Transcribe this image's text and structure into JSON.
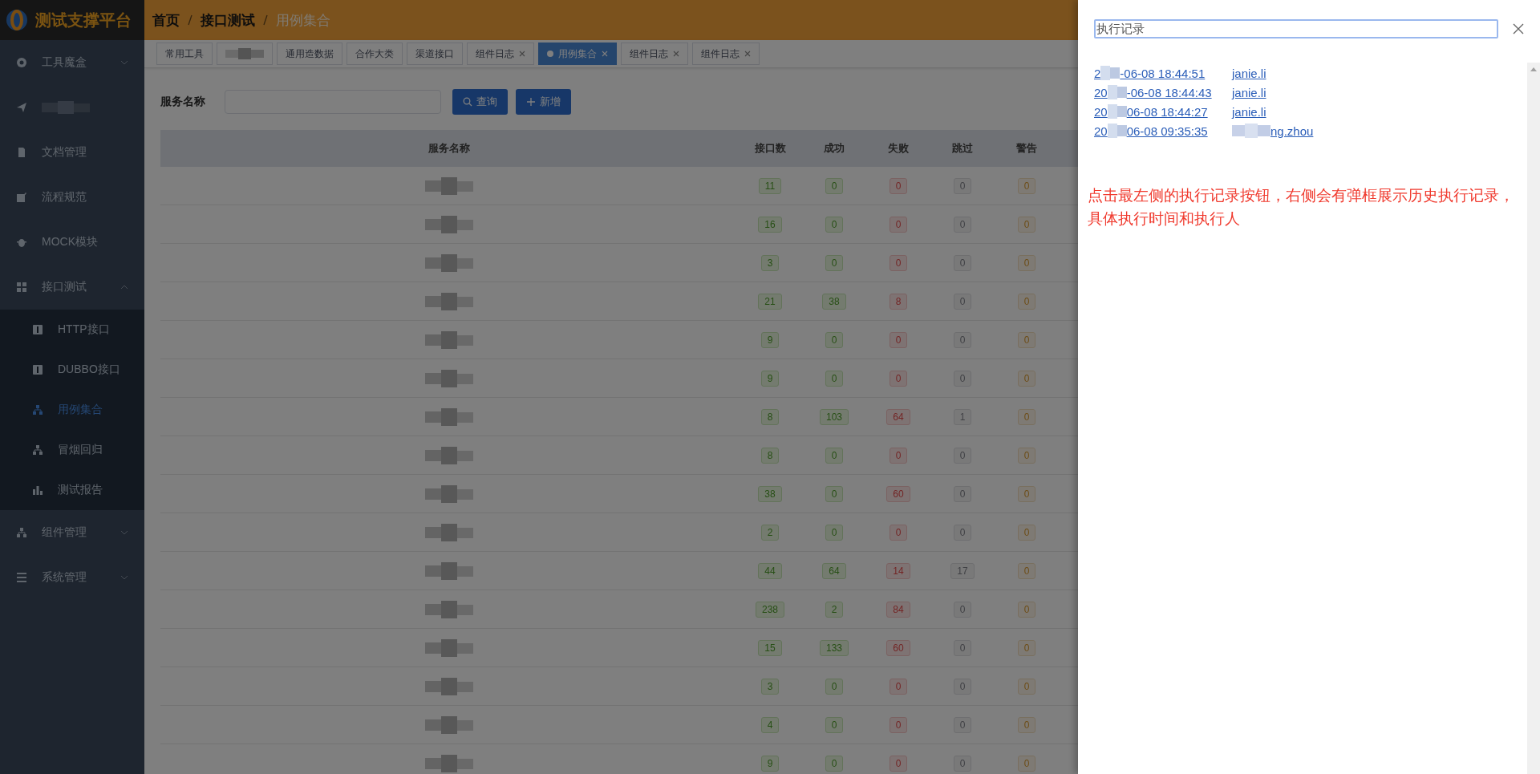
{
  "logo": {
    "title": "测试支撑平台"
  },
  "breadcrumb": [
    "首页",
    "接口测试",
    "用例集合"
  ],
  "sidebar": {
    "items": [
      {
        "label": "工具魔盒",
        "expanded": false
      },
      {
        "masked": true
      },
      {
        "label": "文档管理"
      },
      {
        "label": "流程规范"
      },
      {
        "label": "MOCK模块"
      },
      {
        "label": "接口测试",
        "expanded": true,
        "children": [
          {
            "label": "HTTP接口",
            "selected": false
          },
          {
            "label": "DUBBO接口",
            "selected": false
          },
          {
            "label": "用例集合",
            "selected": true
          },
          {
            "label": "冒烟回归",
            "selected": false
          },
          {
            "label": "测试报告",
            "selected": false
          }
        ]
      },
      {
        "label": "组件管理",
        "expanded": false
      },
      {
        "label": "系统管理",
        "expanded": false
      }
    ]
  },
  "tabs": [
    {
      "label": "常用工具",
      "closable": false,
      "selected": false
    },
    {
      "masked": true,
      "closable": false,
      "selected": false
    },
    {
      "label": "通用造数据",
      "closable": false,
      "selected": false
    },
    {
      "label": "合作大类",
      "closable": false,
      "selected": false
    },
    {
      "label": "渠道接口",
      "closable": false,
      "selected": false
    },
    {
      "label": "组件日志",
      "closable": true,
      "selected": false
    },
    {
      "label": "用例集合",
      "closable": true,
      "selected": true
    },
    {
      "label": "组件日志",
      "closable": true,
      "selected": false
    },
    {
      "label": "组件日志",
      "closable": true,
      "selected": false
    }
  ],
  "search": {
    "label": "服务名称",
    "buttons": [
      "查询",
      "新增"
    ]
  },
  "table": {
    "columns": [
      "服务名称",
      "接口数",
      "成功",
      "失败",
      "跳过",
      "警告"
    ],
    "rows": [
      {
        "cells": [
          "",
          "11",
          "0",
          "0",
          "0",
          "0"
        ]
      },
      {
        "cells": [
          "",
          "16",
          "0",
          "0",
          "0",
          "0"
        ]
      },
      {
        "cells": [
          "",
          "3",
          "0",
          "0",
          "0",
          "0"
        ]
      },
      {
        "cells": [
          "",
          "21",
          "38",
          "8",
          "0",
          "0"
        ]
      },
      {
        "cells": [
          "",
          "9",
          "0",
          "0",
          "0",
          "0"
        ]
      },
      {
        "cells": [
          "",
          "9",
          "0",
          "0",
          "0",
          "0"
        ]
      },
      {
        "cells": [
          "",
          "8",
          "103",
          "64",
          "1",
          "0"
        ]
      },
      {
        "cells": [
          "",
          "8",
          "0",
          "0",
          "0",
          "0"
        ]
      },
      {
        "cells": [
          "",
          "38",
          "0",
          "60",
          "0",
          "0"
        ]
      },
      {
        "cells": [
          "",
          "2",
          "0",
          "0",
          "0",
          "0"
        ]
      },
      {
        "cells": [
          "",
          "44",
          "64",
          "14",
          "17",
          "0"
        ]
      },
      {
        "cells": [
          "",
          "238",
          "2",
          "84",
          "0",
          "0"
        ]
      },
      {
        "cells": [
          "",
          "15",
          "133",
          "60",
          "0",
          "0"
        ]
      },
      {
        "cells": [
          "",
          "3",
          "0",
          "0",
          "0",
          "0"
        ]
      },
      {
        "cells": [
          "",
          "4",
          "0",
          "0",
          "0",
          "0"
        ]
      },
      {
        "cells": [
          "",
          "9",
          "0",
          "0",
          "0",
          "0"
        ]
      }
    ]
  },
  "drawer": {
    "title_field": "执行记录",
    "records": [
      {
        "date_prefix": "2",
        "date": "-06-08 18:44:51",
        "user": "janie.li",
        "user_masked": false
      },
      {
        "date_prefix": "20",
        "date": "-06-08 18:44:43",
        "user": "janie.li",
        "user_masked": false
      },
      {
        "date_prefix": "20",
        "date": "06-08 18:44:27",
        "user": "janie.li",
        "user_masked": false
      },
      {
        "date_prefix": "20",
        "date": "06-08 09:35:35",
        "user": "ng.zhou",
        "user_masked": true
      }
    ],
    "note": "点击最左侧的执行记录按钮，右侧会有弹框展示历史执行记录，具体执行时间和执行人"
  }
}
